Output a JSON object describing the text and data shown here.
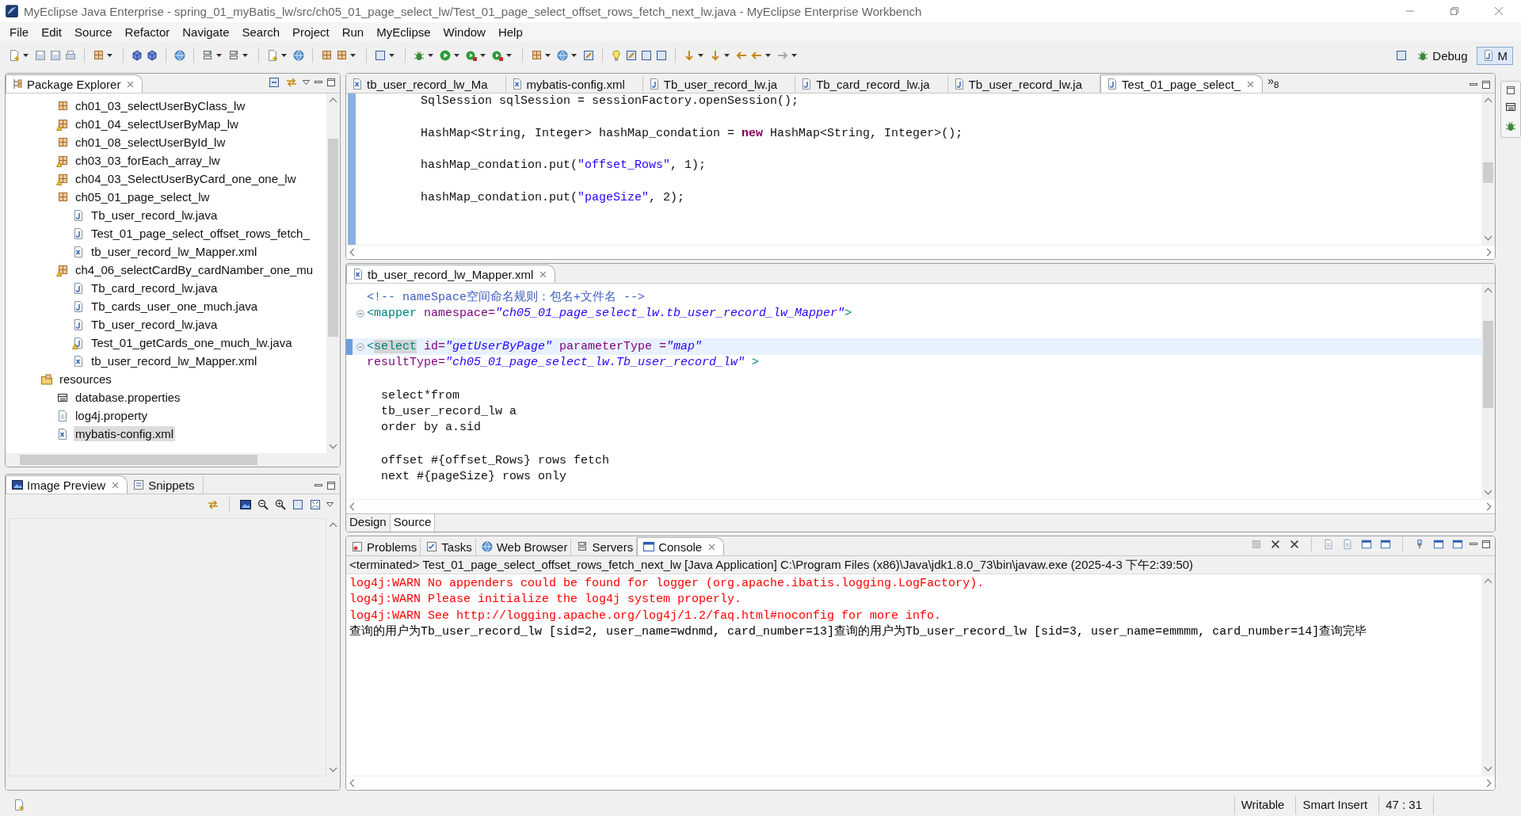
{
  "window": {
    "title": "MyEclipse Java Enterprise - spring_01_myBatis_lw/src/ch05_01_page_select_lw/Test_01_page_select_offset_rows_fetch_next_lw.java - MyEclipse Enterprise Workbench"
  },
  "menu": [
    "File",
    "Edit",
    "Source",
    "Refactor",
    "Navigate",
    "Search",
    "Project",
    "Run",
    "MyEclipse",
    "Window",
    "Help"
  ],
  "perspectives": [
    {
      "label": "Debug",
      "kind": "debug",
      "selected": false
    },
    {
      "label": "M",
      "kind": "java",
      "selected": true
    }
  ],
  "package_explorer": {
    "title": "Package Explorer",
    "tree": [
      {
        "label": "ch01_03_selectUserByClass_lw",
        "kind": "package",
        "selected": false
      },
      {
        "label": "ch01_04_selectUserByMap_lw",
        "kind": "package-warn",
        "selected": false
      },
      {
        "label": "ch01_08_selectUserById_lw",
        "kind": "package",
        "selected": false
      },
      {
        "label": "ch03_03_forEach_array_lw",
        "kind": "package-warn",
        "selected": false
      },
      {
        "label": "ch04_03_SelectUserByCard_one_one_lw",
        "kind": "package-warn",
        "selected": false
      },
      {
        "label": "ch05_01_page_select_lw",
        "kind": "package",
        "selected": false,
        "children": [
          {
            "label": "Tb_user_record_lw.java",
            "kind": "java",
            "selected": false
          },
          {
            "label": "Test_01_page_select_offset_rows_fetch_",
            "kind": "java",
            "selected": false
          },
          {
            "label": "tb_user_record_lw_Mapper.xml",
            "kind": "xml",
            "selected": false
          }
        ]
      },
      {
        "label": "ch4_06_selectCardBy_cardNamber_one_mu",
        "kind": "package-warn",
        "selected": false,
        "children": [
          {
            "label": "Tb_card_record_lw.java",
            "kind": "java",
            "selected": false
          },
          {
            "label": "Tb_cards_user_one_much.java",
            "kind": "java",
            "selected": false
          },
          {
            "label": "Tb_user_record_lw.java",
            "kind": "java",
            "selected": false
          },
          {
            "label": "Test_01_getCards_one_much_lw.java",
            "kind": "java-warn",
            "selected": false
          },
          {
            "label": "tb_user_record_lw_Mapper.xml",
            "kind": "xml",
            "selected": false
          }
        ]
      },
      {
        "label": "resources",
        "kind": "folder",
        "selected": false,
        "children": [
          {
            "label": "database.properties",
            "kind": "properties",
            "selected": false
          },
          {
            "label": "log4j.property",
            "kind": "file",
            "selected": false
          },
          {
            "label": "mybatis-config.xml",
            "kind": "xml",
            "selected": true
          }
        ]
      }
    ]
  },
  "image_preview": {
    "tabs": [
      {
        "label": "Image Preview",
        "kind": "image",
        "selected": true
      },
      {
        "label": "Snippets",
        "kind": "snippets",
        "selected": false
      }
    ]
  },
  "editor_tabs": [
    {
      "label": "tb_user_record_lw_Ma",
      "kind": "xml",
      "selected": false
    },
    {
      "label": "mybatis-config.xml",
      "kind": "xml",
      "selected": false
    },
    {
      "label": "Tb_user_record_lw.ja",
      "kind": "java",
      "selected": false
    },
    {
      "label": "Tb_card_record_lw.ja",
      "kind": "java",
      "selected": false
    },
    {
      "label": "Tb_user_record_lw.ja",
      "kind": "java",
      "selected": false
    },
    {
      "label": "Test_01_page_select_",
      "kind": "java",
      "selected": true
    }
  ],
  "editor_tabs_overflow": "»$_{8}$",
  "java_editor": {
    "lines": [
      {
        "segments": [
          {
            "text": "        SqlSession sqlSession = sessionFactory.openSession();",
            "kind": "plain"
          }
        ]
      },
      {
        "blank_before": true,
        "segments": [
          {
            "text": "        HashMap<String, Integer> hashMap_condation = ",
            "kind": "plain"
          },
          {
            "text": "new",
            "kind": "keyword"
          },
          {
            "text": " HashMap<String, Integer>();",
            "kind": "plain"
          }
        ]
      },
      {
        "blank_before": true,
        "segments": [
          {
            "text": "        hashMap_condation.put(",
            "kind": "plain"
          },
          {
            "text": "\"offset_Rows\"",
            "kind": "string"
          },
          {
            "text": ", 1);",
            "kind": "plain"
          }
        ]
      },
      {
        "blank_before": true,
        "segments": [
          {
            "text": "        hashMap_condation.put(",
            "kind": "plain"
          },
          {
            "text": "\"pageSize\"",
            "kind": "string"
          },
          {
            "text": ", 2);",
            "kind": "plain"
          }
        ]
      }
    ]
  },
  "mapper_editor": {
    "title": "tb_user_record_lw_Mapper.xml",
    "lines": [
      {
        "current": false,
        "segments": [
          {
            "text": "<!-- nameSpace空间命名规则：包名+文件名 -->",
            "kind": "comment"
          }
        ]
      },
      {
        "foldable": true,
        "current": false,
        "segments": [
          {
            "text": "<mapper",
            "kind": "tag"
          },
          {
            "text": " namespace=",
            "kind": "attr"
          },
          {
            "text": "\"ch05_01_page_select_lw.tb_user_record_lw_Mapper\"",
            "kind": "value"
          },
          {
            "text": ">",
            "kind": "tag"
          }
        ]
      },
      {
        "blank_before": true,
        "foldable": true,
        "current": true,
        "segments": [
          {
            "text": "<",
            "kind": "tag"
          },
          {
            "text": "select",
            "kind": "match"
          },
          {
            "text": " id=",
            "kind": "attr"
          },
          {
            "text": "\"getUserByPage\"",
            "kind": "value"
          },
          {
            "text": " parameterType =",
            "kind": "attr"
          },
          {
            "text": "\"map\"",
            "kind": "value"
          }
        ]
      },
      {
        "current": false,
        "segments": [
          {
            "text": "resultType=",
            "kind": "attr"
          },
          {
            "text": "\"ch05_01_page_select_lw.Tb_user_record_lw\"",
            "kind": "value"
          },
          {
            "text": " >",
            "kind": "tag"
          }
        ]
      },
      {
        "blank_before": true,
        "current": false,
        "segments": [
          {
            "text": "  select*from",
            "kind": "plain"
          }
        ]
      },
      {
        "current": false,
        "segments": [
          {
            "text": "  tb_user_record_lw a",
            "kind": "plain"
          }
        ]
      },
      {
        "current": false,
        "segments": [
          {
            "text": "  order by a.sid",
            "kind": "plain"
          }
        ]
      },
      {
        "blank_before": true,
        "current": false,
        "segments": [
          {
            "text": "  offset #{offset_Rows} rows fetch",
            "kind": "plain"
          }
        ]
      },
      {
        "current": false,
        "segments": [
          {
            "text": "  next #{pageSize} rows only",
            "kind": "plain"
          }
        ]
      }
    ],
    "bottom_tabs": [
      {
        "label": "Design",
        "selected": false
      },
      {
        "label": "Source",
        "selected": true
      }
    ]
  },
  "console": {
    "tabs": [
      {
        "label": "Problems",
        "kind": "problems",
        "selected": false
      },
      {
        "label": "Tasks",
        "kind": "tasks",
        "selected": false
      },
      {
        "label": "Web Browser",
        "kind": "browser",
        "selected": false
      },
      {
        "label": "Servers",
        "kind": "servers",
        "selected": false
      },
      {
        "label": "Console",
        "kind": "console",
        "selected": true
      }
    ],
    "header": "<terminated> Test_01_page_select_offset_rows_fetch_next_lw [Java Application] C:\\Program Files (x86)\\Java\\jdk1.8.0_73\\bin\\javaw.exe (2025-4-3 下午2:39:50)",
    "lines": [
      {
        "text": "log4j:WARN No appenders could be found for logger (org.apache.ibatis.logging.LogFactory).",
        "kind": "err"
      },
      {
        "text": "log4j:WARN Please initialize the log4j system properly.",
        "kind": "err"
      },
      {
        "text": "log4j:WARN See http://logging.apache.org/log4j/1.2/faq.html#noconfig for more info.",
        "kind": "err"
      },
      {
        "text": "查询的用户为Tb_user_record_lw [sid=2, user_name=wdnmd, card_number=13]查询的用户为Tb_user_record_lw [sid=3, user_name=emmmm, card_number=14]查询完毕",
        "kind": "out"
      }
    ]
  },
  "status_bar": [
    "Writable",
    "Smart Insert",
    "47 : 31"
  ]
}
